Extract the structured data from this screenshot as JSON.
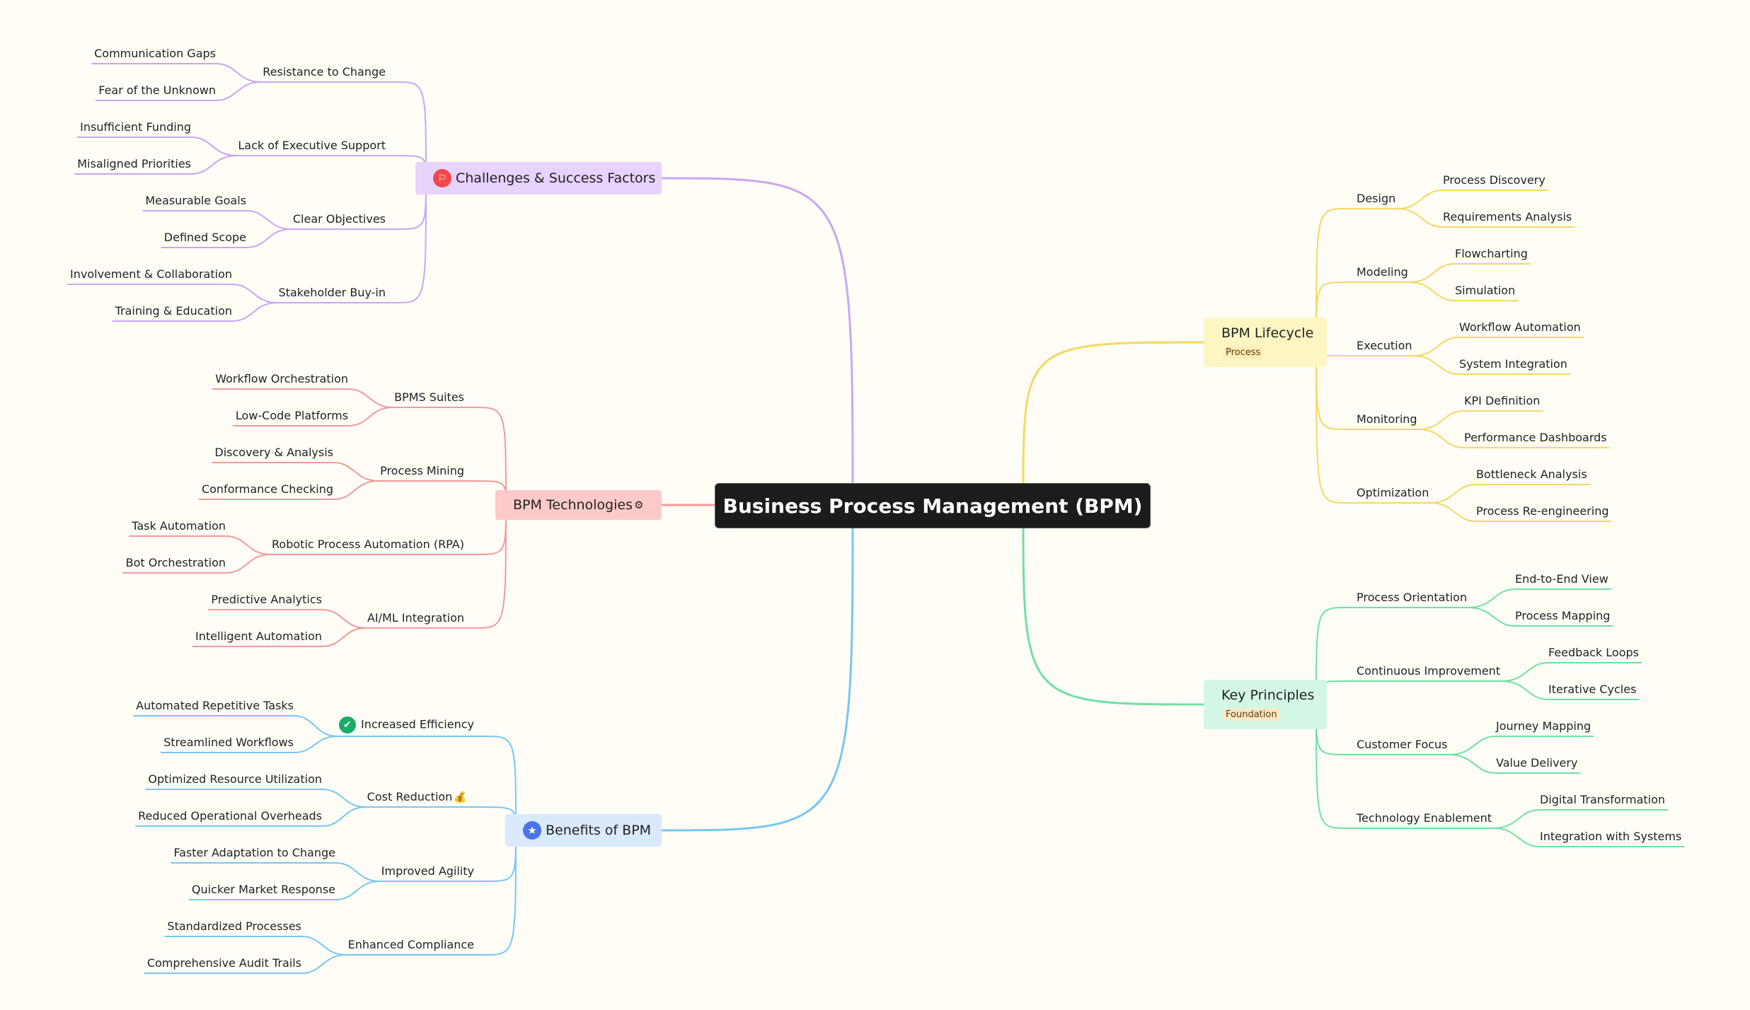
{
  "center": {
    "title": "Business Process Management (BPM)"
  },
  "colors": {
    "challenges": "#c9a6f5",
    "technologies": "#f29a9a",
    "benefits": "#76c7f3",
    "lifecycle": "#f6d862",
    "principles": "#6fe0a3"
  },
  "branches": {
    "challenges": {
      "label": "Challenges & Success Factors",
      "icon": "flag-icon",
      "children": [
        {
          "label": "Resistance to Change",
          "leaves": [
            "Communication Gaps",
            "Fear of the Unknown"
          ]
        },
        {
          "label": "Lack of Executive Support",
          "leaves": [
            "Insufficient Funding",
            "Misaligned Priorities"
          ]
        },
        {
          "label": "Clear Objectives",
          "leaves": [
            "Measurable Goals",
            "Defined Scope"
          ]
        },
        {
          "label": "Stakeholder Buy-in",
          "leaves": [
            "Involvement & Collaboration",
            "Training & Education"
          ]
        }
      ]
    },
    "technologies": {
      "label": "BPM Technologies",
      "emoji": "⚙",
      "children": [
        {
          "label": "BPMS Suites",
          "leaves": [
            "Workflow Orchestration",
            "Low-Code Platforms"
          ]
        },
        {
          "label": "Process Mining",
          "leaves": [
            "Discovery & Analysis",
            "Conformance Checking"
          ]
        },
        {
          "label": "Robotic Process Automation (RPA)",
          "leaves": [
            "Task Automation",
            "Bot Orchestration"
          ]
        },
        {
          "label": "AI/ML Integration",
          "leaves": [
            "Predictive Analytics",
            "Intelligent Automation"
          ]
        }
      ]
    },
    "benefits": {
      "label": "Benefits of BPM",
      "icon": "star-icon",
      "children": [
        {
          "label": "Increased Efficiency",
          "icon": "check-icon",
          "leaves": [
            "Automated Repetitive Tasks",
            "Streamlined Workflows"
          ]
        },
        {
          "label": "Cost Reduction",
          "emoji": "💰",
          "leaves": [
            "Optimized Resource Utilization",
            "Reduced Operational Overheads"
          ]
        },
        {
          "label": "Improved Agility",
          "leaves": [
            "Faster Adaptation to Change",
            "Quicker Market Response"
          ]
        },
        {
          "label": "Enhanced Compliance",
          "leaves": [
            "Standardized Processes",
            "Comprehensive Audit Trails"
          ]
        }
      ]
    },
    "lifecycle": {
      "label": "BPM Lifecycle",
      "tag": "Process",
      "children": [
        {
          "label": "Design",
          "leaves": [
            "Process Discovery",
            "Requirements Analysis"
          ]
        },
        {
          "label": "Modeling",
          "leaves": [
            "Flowcharting",
            "Simulation"
          ]
        },
        {
          "label": "Execution",
          "leaves": [
            "Workflow Automation",
            "System Integration"
          ]
        },
        {
          "label": "Monitoring",
          "leaves": [
            "KPI Definition",
            "Performance Dashboards"
          ]
        },
        {
          "label": "Optimization",
          "leaves": [
            "Bottleneck Analysis",
            "Process Re-engineering"
          ]
        }
      ]
    },
    "principles": {
      "label": "Key Principles",
      "tag": "Foundation",
      "children": [
        {
          "label": "Process Orientation",
          "leaves": [
            "End-to-End View",
            "Process Mapping"
          ]
        },
        {
          "label": "Continuous Improvement",
          "leaves": [
            "Feedback Loops",
            "Iterative Cycles"
          ]
        },
        {
          "label": "Customer Focus",
          "leaves": [
            "Journey Mapping",
            "Value Delivery"
          ]
        },
        {
          "label": "Technology Enablement",
          "leaves": [
            "Digital Transformation",
            "Integration with Systems"
          ]
        }
      ]
    }
  }
}
